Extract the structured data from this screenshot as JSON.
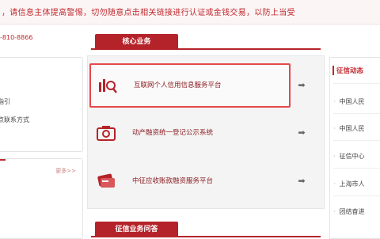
{
  "warning": {
    "text": "，请信息主体提高警惕，切勿随意点击相关链接进行认证或金钱交易，以防上当受"
  },
  "hotline": {
    "text": "-810-8866"
  },
  "left_panel": {
    "items": [
      "指引",
      "点联系方式"
    ]
  },
  "left_lower": {
    "more": "更多>>"
  },
  "core": {
    "title": "核心业务",
    "services": [
      {
        "label": "互联网个人信用信息服务平台",
        "icon": "chart-search-icon"
      },
      {
        "label": "动产融资统一登记公示系统",
        "icon": "camera-icon"
      },
      {
        "label": "中征应收账款融资服务平台",
        "icon": "card-icon"
      }
    ],
    "arrow": "➡"
  },
  "qa": {
    "title": "征信业务问答"
  },
  "right_panel": {
    "title": "征信动态",
    "news": [
      "中国人民",
      "中国人民",
      "征信中心",
      "上海市人",
      "团结奋进"
    ]
  },
  "colors": {
    "brand_red": "#b5232a",
    "highlight": "#e6484b"
  }
}
